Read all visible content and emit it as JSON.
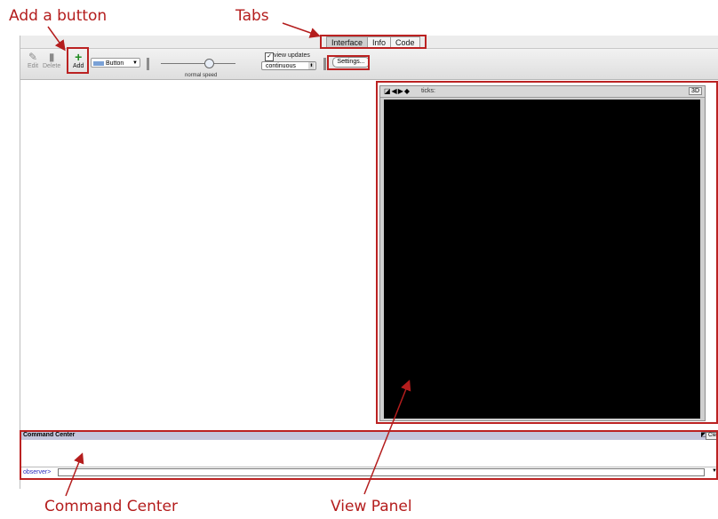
{
  "tabs": [
    "Interface",
    "Info",
    "Code"
  ],
  "toolbar": {
    "edit_label": "Edit",
    "delete_label": "Delete",
    "add_label": "Add",
    "widget_type": "Button",
    "speed_label": "normal speed",
    "view_updates_label": "view updates",
    "update_mode": "continuous",
    "settings_label": "Settings..."
  },
  "view": {
    "ticks_label": "ticks:",
    "mode_3d_label": "3D"
  },
  "command_center": {
    "title": "Command Center",
    "clear_label": "Cle",
    "prompt": "observer>"
  },
  "annotations": {
    "add_button": "Add a button",
    "tabs": "Tabs",
    "command_center": "Command Center",
    "view_panel": "View Panel"
  },
  "colors": {
    "annotation": "#b41d1d",
    "world_background": "#000000",
    "command_center_header": "#c4c6dc"
  }
}
